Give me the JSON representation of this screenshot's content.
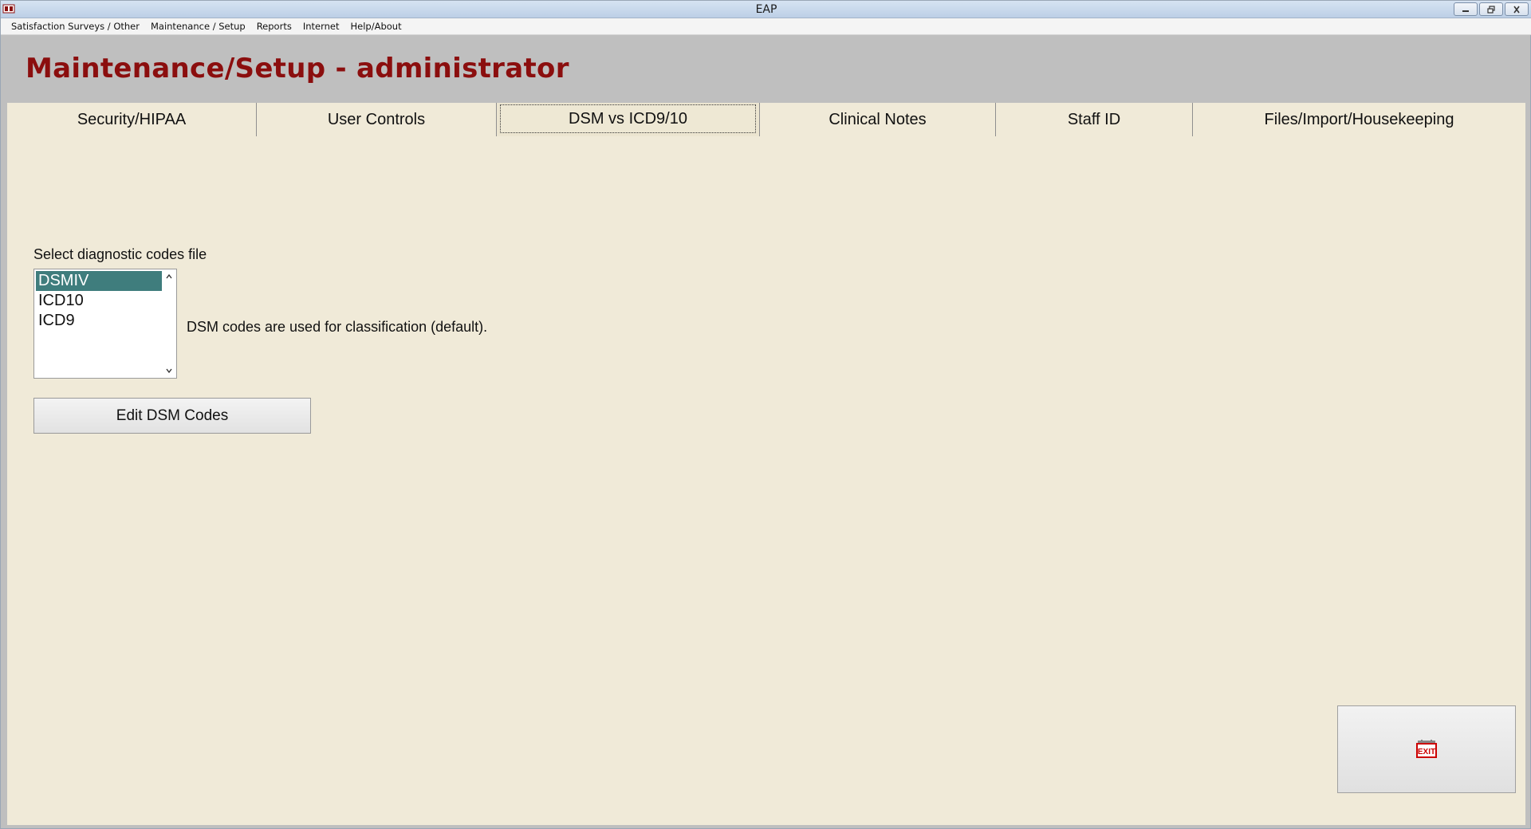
{
  "window": {
    "title": "EAP",
    "controls": {
      "minimize_icon": "minimize-icon",
      "restore_icon": "restore-icon",
      "close_icon": "close-icon"
    }
  },
  "menu": {
    "items": [
      {
        "label": "Satisfaction Surveys / Other"
      },
      {
        "label": "Maintenance / Setup"
      },
      {
        "label": "Reports"
      },
      {
        "label": "Internet"
      },
      {
        "label": "Help/About"
      }
    ]
  },
  "header": {
    "title": "Maintenance/Setup - administrator",
    "title_color": "#8b0e0e"
  },
  "tabs": [
    {
      "label": "Security/HIPAA"
    },
    {
      "label": "User Controls"
    },
    {
      "label": "DSM vs ICD9/10",
      "active": true
    },
    {
      "label": "Clinical Notes"
    },
    {
      "label": "Staff ID"
    },
    {
      "label": "Files/Import/Housekeeping"
    }
  ],
  "content": {
    "select_label": "Select diagnostic codes file",
    "codes_list": {
      "options": [
        "DSMIV",
        "ICD10",
        "ICD9"
      ],
      "selected": "DSMIV",
      "selection_color": "#3f7d7d"
    },
    "description": "DSM codes are used for classification (default).",
    "edit_button_label": "Edit DSM Codes",
    "exit_icon": "exit-sign-icon",
    "exit_label": "EXIT"
  },
  "colors": {
    "content_bg": "#f0ead8",
    "header_bg": "#bfbfbf"
  }
}
